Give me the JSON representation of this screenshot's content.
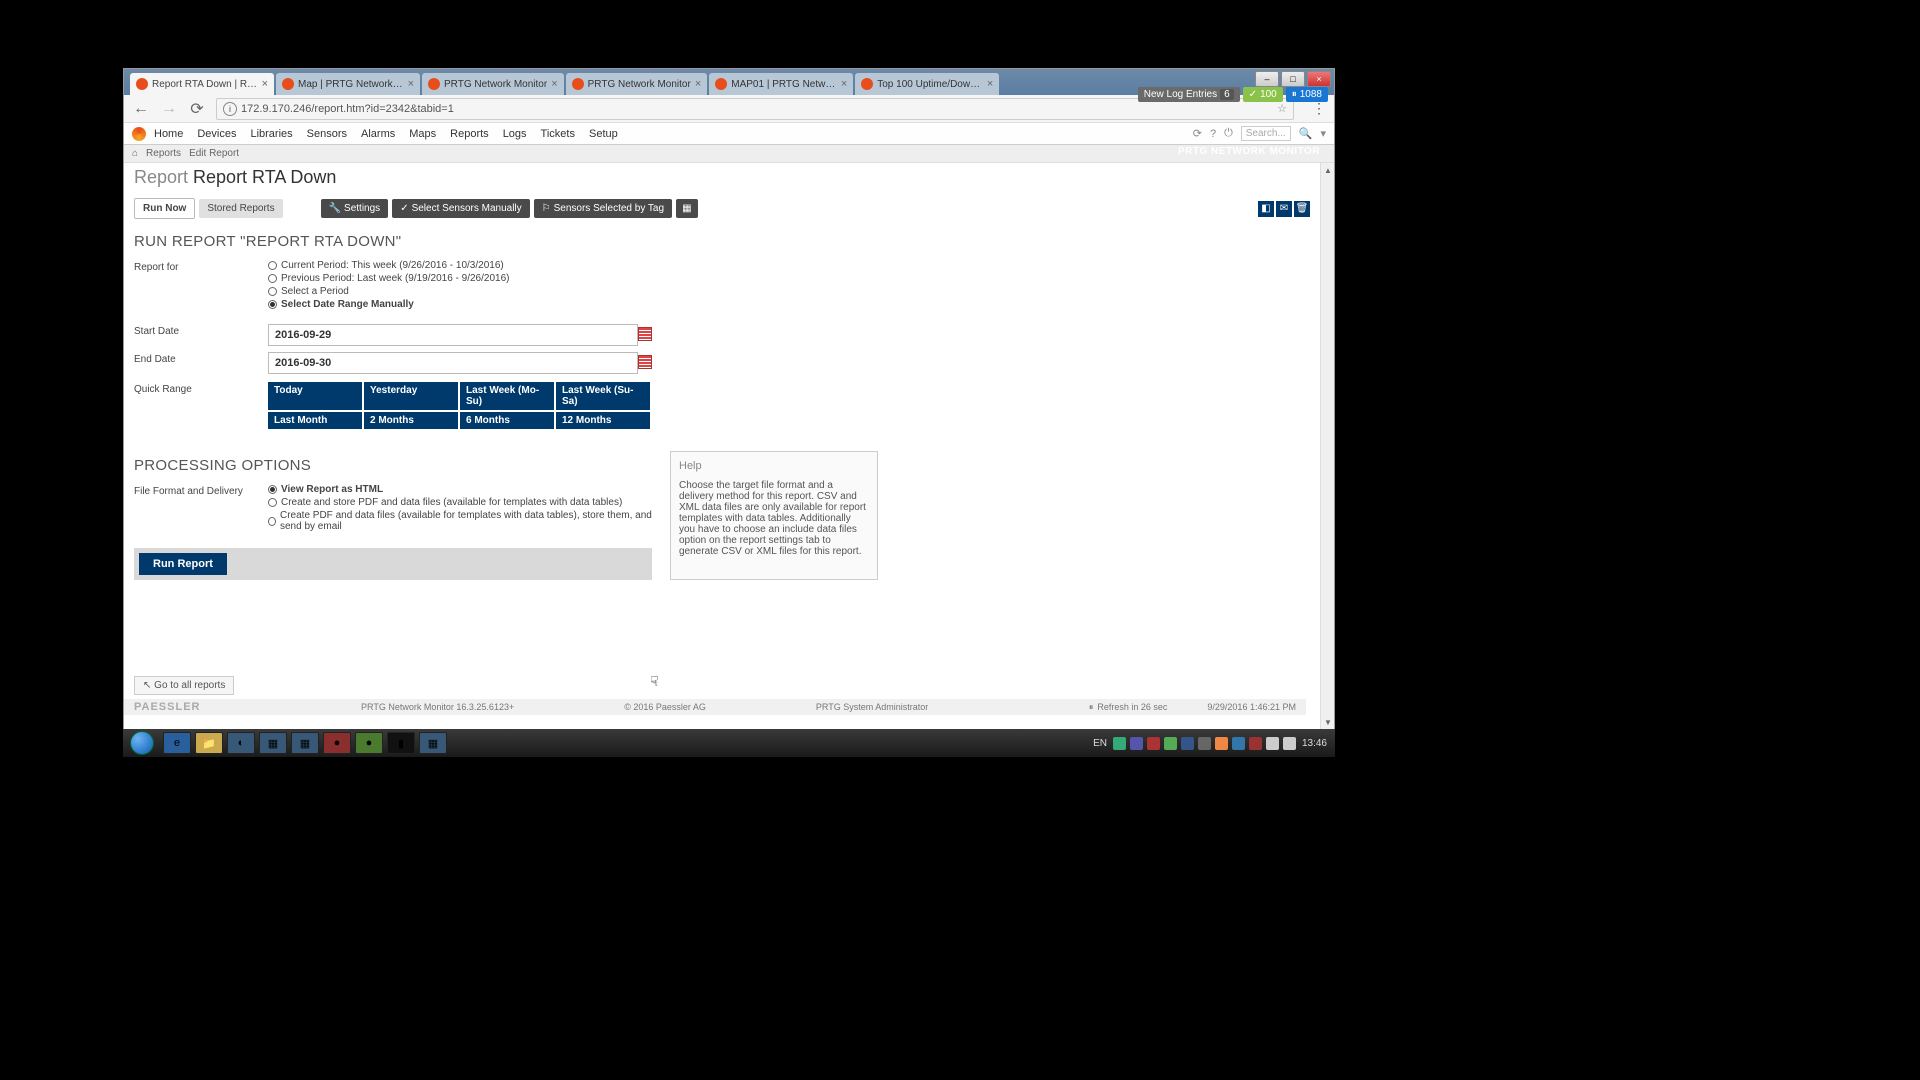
{
  "browser": {
    "tabs": [
      {
        "title": "Report RTA Down | Rep...",
        "active": true
      },
      {
        "title": "Map | PRTG Network M...",
        "active": false
      },
      {
        "title": "PRTG Network Monitor",
        "active": false
      },
      {
        "title": "PRTG Network Monitor",
        "active": false
      },
      {
        "title": "MAP01 | PRTG Network...",
        "active": false
      },
      {
        "title": "Top 100 Uptime/Downt...",
        "active": false
      }
    ],
    "url": "172.9.170.246/report.htm?id=2342&tabid=1"
  },
  "topnav": {
    "items": [
      "Home",
      "Devices",
      "Libraries",
      "Sensors",
      "Alarms",
      "Maps",
      "Reports",
      "Logs",
      "Tickets",
      "Setup"
    ],
    "search_placeholder": "Search..."
  },
  "breadcrumb": {
    "items": [
      "Reports",
      "Edit Report"
    ],
    "brand": "PRTG NETWORK MONITOR"
  },
  "status": {
    "newlog_label": "New Log Entries",
    "newlog_count": "6",
    "green_count": "100",
    "blue_count": "1088"
  },
  "page": {
    "title_prefix": "Report ",
    "title_name": "Report RTA Down",
    "tabs": {
      "run_now": "Run Now",
      "stored": "Stored Reports",
      "settings": "Settings",
      "select_manual": "Select Sensors Manually",
      "select_tag": "Sensors Selected by Tag"
    },
    "section_run": "RUN REPORT \"REPORT RTA DOWN\"",
    "section_proc": "PROCESSING OPTIONS"
  },
  "form": {
    "report_for_label": "Report for",
    "report_for_options": {
      "current": "Current Period: This week (9/26/2016 - 10/3/2016)",
      "previous": "Previous Period: Last week (9/19/2016 - 9/26/2016)",
      "select": "Select a Period",
      "manual": "Select Date Range Manually"
    },
    "start_label": "Start Date",
    "start_value": "2016-09-29",
    "end_label": "End Date",
    "end_value": "2016-09-30",
    "quick_label": "Quick Range",
    "quick": [
      "Today",
      "Yesterday",
      "Last Week (Mo-Su)",
      "Last Week (Su-Sa)",
      "Last Month",
      "2 Months",
      "6 Months",
      "12 Months"
    ],
    "delivery_label": "File Format and Delivery",
    "delivery_options": {
      "html": "View Report as HTML",
      "pdf": "Create and store PDF and data files (available for templates with data tables)",
      "email": "Create PDF and data files (available for templates with data tables), store them, and send by email"
    },
    "run_button": "Run Report"
  },
  "help": {
    "title": "Help",
    "body": "Choose the target file format and a delivery method for this report. CSV and XML data files are only available for report templates with data tables. Additionally you have to choose an include data files option on the report settings tab to generate CSV or XML files for this report."
  },
  "footer": {
    "goto": "Go to all reports",
    "paessler": "PAESSLER",
    "version": "PRTG Network Monitor 16.3.25.6123+",
    "copyright": "© 2016 Paessler AG",
    "user": "PRTG System Administrator",
    "refresh": "Refresh in 26 sec",
    "date": "9/29/2016 1:46:21 PM"
  },
  "taskbar": {
    "lang": "EN",
    "time": "13:46"
  }
}
